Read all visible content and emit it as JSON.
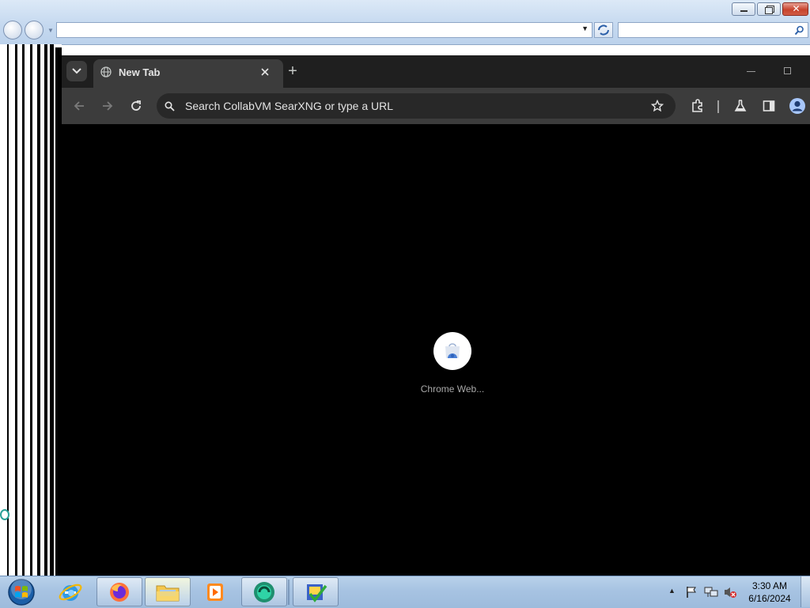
{
  "ie": {
    "address_value": "",
    "search_value": ""
  },
  "chrome": {
    "tab_title": "New Tab",
    "new_tab_symbol": "+",
    "omnibox_placeholder": "Search CollabVM SearXNG or type a URL",
    "shortcut_label": "Chrome Web..."
  },
  "taskbar": {
    "items": [
      "start-orb",
      "internet-explorer",
      "firefox",
      "windows-explorer",
      "media-player",
      "app-teal",
      "app-checklist"
    ],
    "clock_time": "3:30 AM",
    "clock_date": "6/16/2024"
  },
  "icons": {
    "chrome_nav": [
      "back-arrow-icon",
      "forward-arrow-icon",
      "reload-icon"
    ],
    "chrome_right": [
      "bookmark-star-icon",
      "extensions-icon",
      "labs-icon",
      "side-panel-icon",
      "profile-icon"
    ]
  },
  "colors": {
    "chrome_frame": "#1f1f1f",
    "chrome_toolbar": "#3c3c3c",
    "omnibox": "#282828",
    "taskbar": "#a7c3e2"
  }
}
